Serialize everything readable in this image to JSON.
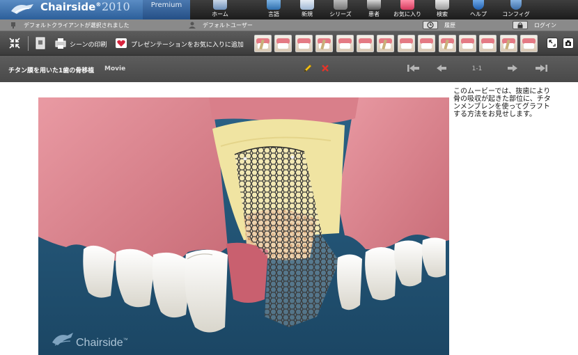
{
  "app": {
    "brand": "Chairside",
    "brand_mark": "®",
    "year": "2010",
    "edition": "Premium"
  },
  "nav": [
    {
      "label": "ホーム",
      "icon": "home-icon"
    },
    {
      "label": "言語",
      "icon": "language-icon"
    },
    {
      "label": "新規",
      "icon": "new-icon"
    },
    {
      "label": "シリーズ",
      "icon": "series-icon"
    },
    {
      "label": "患者",
      "icon": "patient-icon"
    },
    {
      "label": "お気に入り",
      "icon": "favorites-icon"
    },
    {
      "label": "検索",
      "icon": "search-icon"
    },
    {
      "label": "ヘルプ",
      "icon": "help-icon"
    },
    {
      "label": "コンフィグ",
      "icon": "config-icon"
    }
  ],
  "status": {
    "client": "デフォルトクライアントが選択されました",
    "user": "デフォルトユーザー",
    "history": "履歴",
    "login": "ログイン"
  },
  "toolbar": {
    "print_scene": "シーンの印刷",
    "add_favorite": "プレゼンテーションをお気に入りに追加",
    "thumbnail_count": 14
  },
  "presentation": {
    "title": "チタン膜を用いた1歯の骨移植",
    "media_type": "Movie",
    "pager": "1-1"
  },
  "description": "このムービーでは、抜歯により骨の吸収が起きた部位に、チタンメンブレンを使ってグラフトする方法をお見せします。",
  "watermark": "Chairside",
  "watermark_mark": "™",
  "colors": {
    "brand_blue": "#3a6fae",
    "toolbar_dark": "#3b3b3b",
    "status_gray": "#8a8a8a",
    "scene_bg": "#23577a",
    "gum_pink": "#e58f98",
    "bone_yellow": "#f0e4a2",
    "tooth_white": "#f6f4ee",
    "edit_yellow": "#f3c21a",
    "delete_red": "#e3342a"
  }
}
